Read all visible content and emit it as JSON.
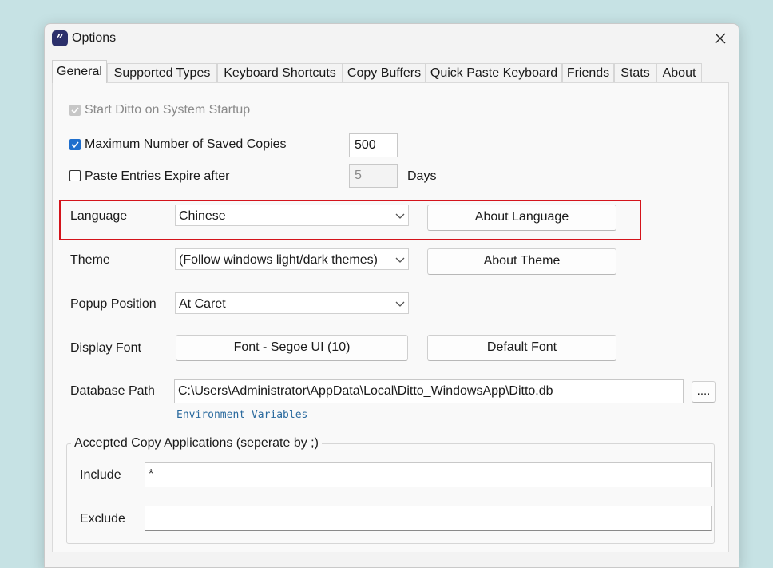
{
  "window": {
    "title": "Options",
    "app_icon_glyph": "”"
  },
  "tabs": [
    {
      "label": "General",
      "active": true
    },
    {
      "label": "Supported Types"
    },
    {
      "label": "Keyboard Shortcuts"
    },
    {
      "label": "Copy Buffers"
    },
    {
      "label": "Quick Paste Keyboard"
    },
    {
      "label": "Friends"
    },
    {
      "label": "Stats"
    },
    {
      "label": "About"
    }
  ],
  "general": {
    "start_on_startup": {
      "label": "Start Ditto on System Startup",
      "checked": true,
      "disabled": true
    },
    "max_copies": {
      "label": "Maximum Number of Saved Copies",
      "checked": true,
      "value": "500"
    },
    "expire": {
      "label": "Paste Entries Expire after",
      "checked": false,
      "value": "5",
      "unit": "Days"
    },
    "language": {
      "label": "Language",
      "value": "Chinese",
      "button": "About Language"
    },
    "theme": {
      "label": "Theme",
      "value": "(Follow windows light/dark themes)",
      "button": "About Theme"
    },
    "popup_position": {
      "label": "Popup Position",
      "value": "At Caret"
    },
    "display_font": {
      "label": "Display Font",
      "font_button": "Font - Segoe UI (10)",
      "default_button": "Default Font"
    },
    "database_path": {
      "label": "Database Path",
      "value": "C:\\Users\\Administrator\\AppData\\Local\\Ditto_WindowsApp\\Ditto.db",
      "browse_button": "....",
      "env_link": "Environment Variables"
    },
    "accepted_apps": {
      "title": "Accepted Copy Applications (seperate by ;)",
      "include_label": "Include",
      "include_value": "*",
      "exclude_label": "Exclude",
      "exclude_value": ""
    }
  },
  "colors": {
    "accent": "#1f6fcd",
    "highlight_border": "#d4141c",
    "link": "#2a6a9e",
    "desktop": "#c6e2e4"
  }
}
